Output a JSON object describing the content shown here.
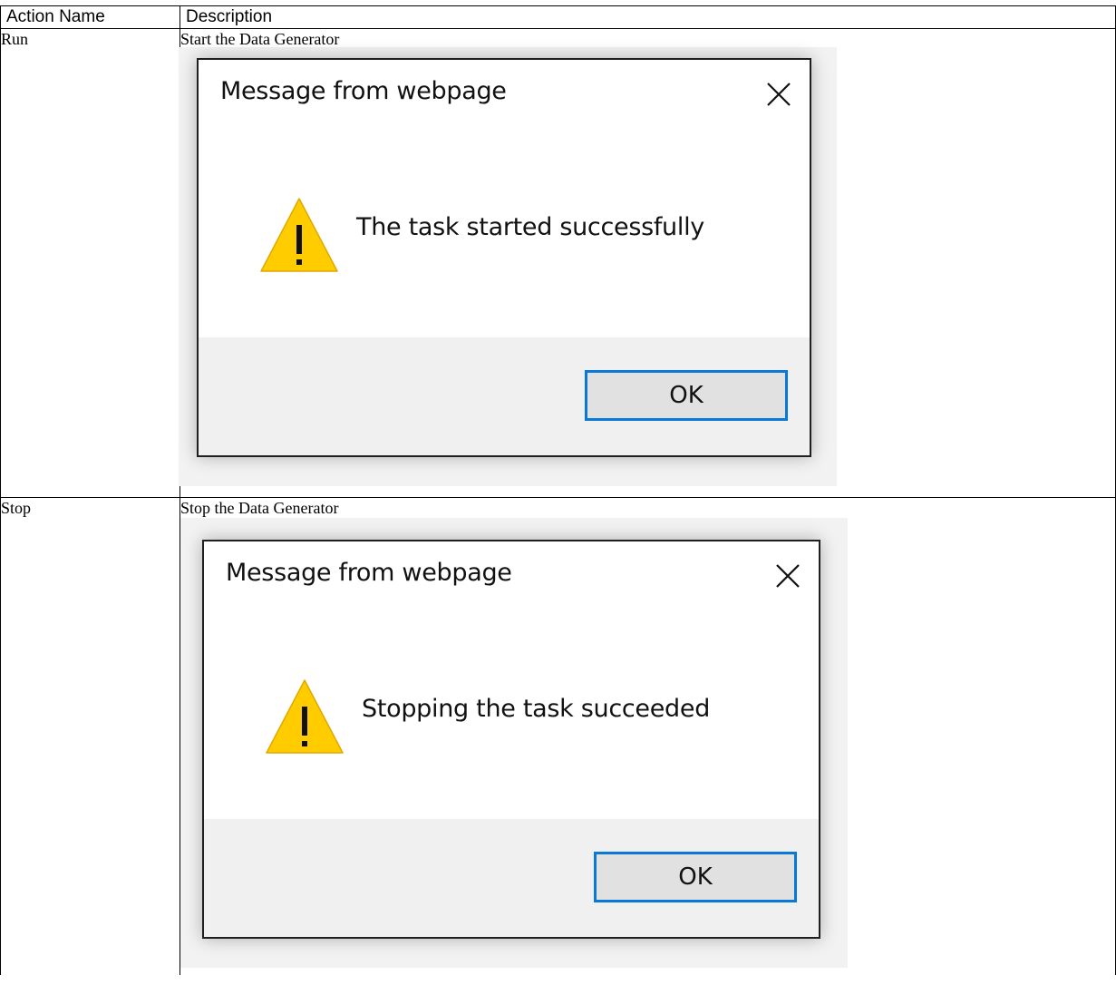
{
  "table": {
    "headers": {
      "action_name": "Action Name",
      "description": "Description"
    },
    "rows": [
      {
        "name": "Run",
        "description": "Start the Data Generator",
        "dialog": {
          "title": "Message from webpage",
          "message": "The task started successfully",
          "ok_label": "OK",
          "icon": "warning-icon",
          "close_icon": "close-icon"
        }
      },
      {
        "name": "Stop",
        "description": "Stop the Data Generator",
        "dialog": {
          "title": "Message from webpage",
          "message": "Stopping the task succeeded",
          "ok_label": "OK",
          "icon": "warning-icon",
          "close_icon": "close-icon"
        }
      }
    ]
  },
  "colors": {
    "warning_fill": "#ffcc00",
    "ok_border": "#0a78d7",
    "footer_bg": "#f0f0f0"
  }
}
